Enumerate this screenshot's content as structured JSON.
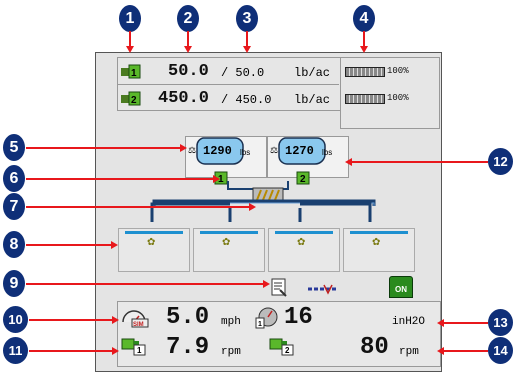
{
  "callouts": [
    "1",
    "2",
    "3",
    "4",
    "5",
    "6",
    "7",
    "8",
    "9",
    "10",
    "11",
    "12",
    "13",
    "14"
  ],
  "product1": {
    "number": "1",
    "rate": "50.0",
    "target": "/ 50.0",
    "unit": "lb/ac",
    "percent": "100%",
    "fill": 1.0
  },
  "product2": {
    "number": "2",
    "rate": "450.0",
    "target": "/ 450.0",
    "unit": "lb/ac",
    "percent": "100%",
    "fill": 1.0
  },
  "bin1": {
    "number": "1",
    "weight": "1290",
    "unit": "lbs"
  },
  "bin2": {
    "number": "2",
    "weight": "1270",
    "unit": "lbs"
  },
  "speed": {
    "value": "5.0",
    "unit": "mph",
    "badge": "SIM"
  },
  "fan1": {
    "value": "7.9",
    "unit": "rpm",
    "number": "1"
  },
  "fan2": {
    "value": "80",
    "unit": "rpm",
    "number": "2"
  },
  "pressure": {
    "value": "16",
    "unit": "inH2O",
    "number": "1"
  },
  "status": {
    "master": "ON"
  },
  "colors": {
    "callout": "#0f2f78",
    "arrow": "#e8181c",
    "product": "#2a8a1e",
    "bin": "#1e90d0"
  }
}
